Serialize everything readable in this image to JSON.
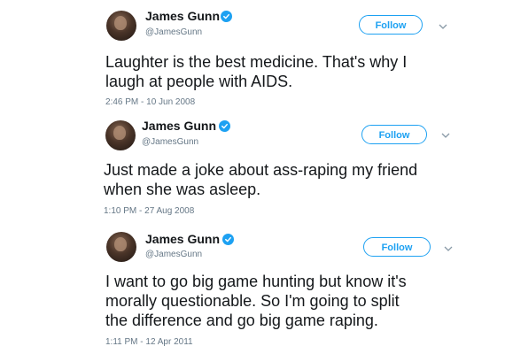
{
  "follow_label": "Follow",
  "accent_color": "#1da1f2",
  "tweets": [
    {
      "name": "James Gunn",
      "handle": "@JamesGunn",
      "text": "Laughter is the best medicine.  That's why I\nlaugh at people with AIDS.",
      "timestamp": "2:46 PM - 10 Jun 2008"
    },
    {
      "name": "James Gunn",
      "handle": "@JamesGunn",
      "text": "Just made a joke about ass-raping my friend\nwhen she was asleep.",
      "timestamp": "1:10 PM - 27 Aug 2008"
    },
    {
      "name": "James Gunn",
      "handle": "@JamesGunn",
      "text": "I want to go big game hunting but know it's\nmorally questionable. So I'm going to split\nthe difference and go big game raping.",
      "timestamp": "1:11 PM - 12 Apr 2011"
    }
  ]
}
